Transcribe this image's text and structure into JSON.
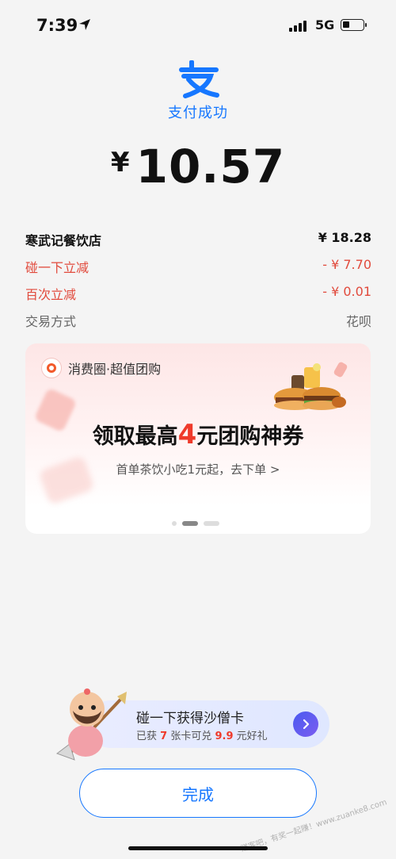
{
  "status_bar": {
    "time": "7:39",
    "network": "5G"
  },
  "payment": {
    "status": "支付成功",
    "currency": "¥",
    "amount": "10.57"
  },
  "details": [
    {
      "label": "寒武记餐饮店",
      "value": "¥ 18.28"
    },
    {
      "label": "碰一下立减",
      "value": "- ¥ 7.70"
    },
    {
      "label": "百次立减",
      "value": "- ¥ 0.01"
    },
    {
      "label": "交易方式",
      "value": "花呗"
    }
  ],
  "banner": {
    "header": "消费圈·超值团购",
    "title_prefix": "领取最高",
    "title_number": "4",
    "title_suffix": "元团购神券",
    "subtitle": "首单茶饮小吃1元起，去下单",
    "subtitle_arrow": ">"
  },
  "promo": {
    "title": "碰一下获得沙僧卡",
    "line_prefix": "已获",
    "count": "7",
    "line_middle": "张卡可兑",
    "price": "9.9",
    "line_suffix": "元好礼"
  },
  "done_label": "完成",
  "watermark": "赚客吧，有奖一起赚！www.zuanke8.com",
  "colors": {
    "accent": "#1677ff",
    "red": "#e14a3c",
    "banner_red": "#ef3a2b"
  },
  "icons": [
    "location-arrow-icon",
    "signal-icon",
    "battery-icon",
    "alipay-logo-icon",
    "chevron-right-icon"
  ]
}
